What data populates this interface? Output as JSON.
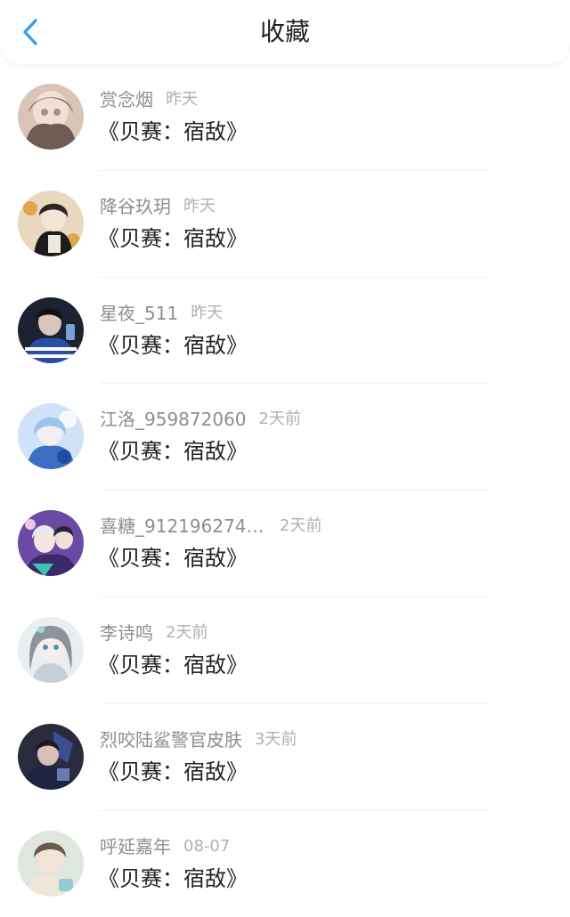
{
  "header": {
    "title": "收藏"
  },
  "colors": {
    "accent": "#2e9cf0",
    "text_primary": "#222222",
    "text_secondary": "#8e8e8e",
    "text_time": "#b0b0b0"
  },
  "items": [
    {
      "name": "赏念烟",
      "time": "昨天",
      "book": "《贝赛：宿敌》",
      "avatar": "avatar-icon"
    },
    {
      "name": "降谷玖玥",
      "time": "昨天",
      "book": "《贝赛：宿敌》",
      "avatar": "avatar-icon"
    },
    {
      "name": "星夜_511",
      "time": "昨天",
      "book": "《贝赛：宿敌》",
      "avatar": "avatar-icon"
    },
    {
      "name": "江洛_959872060",
      "time": "2天前",
      "book": "《贝赛：宿敌》",
      "avatar": "avatar-icon"
    },
    {
      "name": "喜糖_9121962745...",
      "time": "2天前",
      "book": "《贝赛：宿敌》",
      "avatar": "avatar-icon"
    },
    {
      "name": "李诗鸣",
      "time": "2天前",
      "book": "《贝赛：宿敌》",
      "avatar": "avatar-icon"
    },
    {
      "name": "烈咬陆鲨警官皮肤",
      "time": "3天前",
      "book": "《贝赛：宿敌》",
      "avatar": "avatar-icon"
    },
    {
      "name": "呼延嘉年",
      "time": "08-07",
      "book": "《贝赛：宿敌》",
      "avatar": "avatar-icon"
    }
  ]
}
